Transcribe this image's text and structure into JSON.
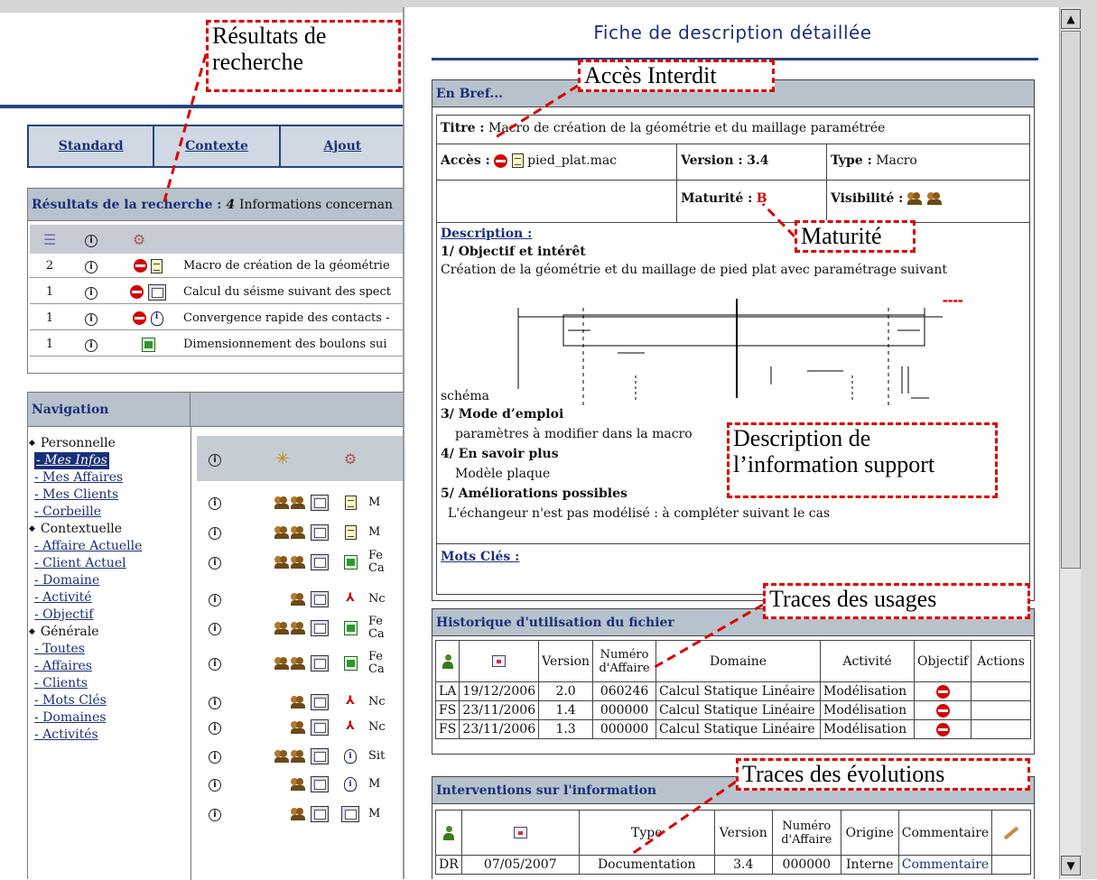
{
  "background": {
    "tabs": [
      "Standard",
      "Contexte",
      "Ajout"
    ],
    "results_header": {
      "label": "Résultats de la recherche :",
      "count": "4",
      "suffix": "Informations concernan"
    },
    "results_rows": [
      {
        "count": "2",
        "icons": [
          "stop",
          "doc"
        ],
        "text": "Macro de création de la géométrie"
      },
      {
        "count": "1",
        "icons": [
          "stop",
          "form"
        ],
        "text": "Calcul du séisme suivant des spect"
      },
      {
        "count": "1",
        "icons": [
          "stop",
          "bulb"
        ],
        "text": "Convergence rapide des contacts -"
      },
      {
        "count": "1",
        "icons": [
          "xls"
        ],
        "text": "Dimensionnement des boulons sui"
      }
    ],
    "navigation": {
      "title": "Navigation",
      "groups": [
        {
          "label": "Personnelle",
          "items": [
            "- Mes Infos",
            "- Mes Affaires",
            "- Mes Clients",
            "- Corbeille"
          ]
        },
        {
          "label": "Contextuelle",
          "items": [
            "- Affaire Actuelle",
            "- Client Actuel",
            "- Domaine",
            "- Activité",
            "- Objectif"
          ]
        },
        {
          "label": "Générale",
          "items": [
            "- Toutes",
            "- Affaires",
            "- Clients",
            "- Mots Clés",
            "- Domaines",
            "- Activités"
          ]
        }
      ]
    },
    "list_rows": [
      {
        "type": "doc",
        "t1": "M",
        "t2": "",
        "users": 2
      },
      {
        "type": "doc",
        "t1": "M",
        "t2": "",
        "users": 2
      },
      {
        "type": "xls",
        "t1": "Fe",
        "t2": "Ca",
        "users": 2
      },
      {
        "type": "pdf",
        "t1": "Nc",
        "t2": "",
        "users": 1
      },
      {
        "type": "xls",
        "t1": "Fe",
        "t2": "Ca",
        "users": 2
      },
      {
        "type": "xls",
        "t1": "Fe",
        "t2": "Ca",
        "users": 2
      },
      {
        "type": "pdf",
        "t1": "Nc",
        "t2": "",
        "users": 1
      },
      {
        "type": "pdf",
        "t1": "Nc",
        "t2": "",
        "users": 1
      },
      {
        "type": "bulb",
        "t1": "Sit",
        "t2": "",
        "users": 2
      },
      {
        "type": "bulb",
        "t1": "M",
        "t2": "",
        "users": 1
      },
      {
        "type": "form",
        "t1": "M",
        "t2": "",
        "users": 1
      }
    ]
  },
  "popup": {
    "title": "Fiche de description détaillée",
    "en_bref": {
      "header": "En Bref...",
      "titre_label": "Titre :",
      "titre_value": "Macro de création de la géométrie et du maillage paramétrée",
      "acces_label": "Accès :",
      "acces_file": "pied_plat.mac",
      "version_label": "Version :",
      "version_value": "3.4",
      "type_label": "Type :",
      "type_value": "Macro",
      "maturite_label": "Maturité :",
      "maturite_value": "B",
      "visibilite_label": "Visibilité :",
      "description_label": "Description :",
      "s1_title": "1/ Objectif et intérêt",
      "s1_text": "Création de la géométrie et du maillage de pied plat avec paramétrage suivant",
      "schema_label": "schéma",
      "s3_title": "3/ Mode d’emploi",
      "s3_text": "paramètres à modifier dans la macro",
      "s4_title": "4/ En savoir plus",
      "s4_text": "Modèle plaque",
      "s5_title": "5/ Améliorations possibles",
      "s5_text": "L'échangeur n'est pas modélisé : à compléter suivant le cas",
      "mots_cles": "Mots Clés :"
    },
    "historique": {
      "header": "Historique d'utilisation du fichier",
      "columns": [
        "",
        "",
        "Version",
        "Numéro d'Affaire",
        "Domaine",
        "Activité",
        "Objectif",
        "Actions"
      ],
      "rows": [
        {
          "user": "LA",
          "date": "19/12/2006",
          "version": "2.0",
          "affaire": "060246",
          "domaine": "Calcul Statique Linéaire",
          "activite": "Modélisation"
        },
        {
          "user": "FS",
          "date": "23/11/2006",
          "version": "1.4",
          "affaire": "000000",
          "domaine": "Calcul Statique Linéaire",
          "activite": "Modélisation"
        },
        {
          "user": "FS",
          "date": "23/11/2006",
          "version": "1.3",
          "affaire": "000000",
          "domaine": "Calcul Statique Linéaire",
          "activite": "Modélisation"
        }
      ]
    },
    "interventions": {
      "header": "Interventions sur l'information",
      "columns": [
        "",
        "",
        "Type",
        "Version",
        "Numéro d'Affaire",
        "Origine",
        "Commentaire",
        ""
      ],
      "rows": [
        {
          "user": "DR",
          "date": "07/05/2007",
          "type": "Documentation",
          "version": "3.4",
          "affaire": "000000",
          "origine": "Interne",
          "commentaire": "Commentaire"
        }
      ]
    }
  },
  "annotations": {
    "resultats": "Résultats de recherche",
    "acces": "Accès Interdit",
    "maturite": "Maturité",
    "description": "Description de l’information support",
    "usages": "Traces des usages",
    "evolutions": "Traces des évolutions"
  },
  "colors": {
    "accent": "#24457a",
    "header_bg": "#b8c2cc",
    "annotation": "#dd0000",
    "forbidden": "#d40000"
  }
}
